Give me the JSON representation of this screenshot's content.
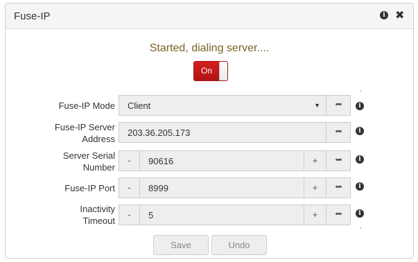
{
  "dialog": {
    "title": "Fuse-IP",
    "icons": {
      "info": "info-icon",
      "close": "close-icon"
    },
    "close_glyph": "✖",
    "info_glyph": "i"
  },
  "status_text": "Started, dialing server....",
  "toggle": {
    "label": "On",
    "state": "on",
    "accent": "#c41a1a"
  },
  "fields": {
    "mode": {
      "label": "Fuse-IP Mode",
      "value": "Client",
      "arrow": "▼"
    },
    "server_address": {
      "label_line1": "Fuse-IP Server",
      "label_line2": "Address",
      "value": "203.36.205.173"
    },
    "serial_number": {
      "label_line1": "Server Serial",
      "label_line2": "Number",
      "value": "90616",
      "minus": "-",
      "plus": "+"
    },
    "port": {
      "label": "Fuse-IP Port",
      "value": "8999",
      "minus": "-",
      "plus": "+"
    },
    "inactivity": {
      "label_line1": "Inactivity",
      "label_line2": "Timeout",
      "value": "5",
      "minus": "-",
      "plus": "+"
    }
  },
  "more_glyph": "•••",
  "buttons": {
    "save": "Save",
    "undo": "Undo"
  },
  "colors": {
    "status_text": "#7a6225",
    "panel_bg": "#f5f5f5",
    "field_bg": "#eeeeee"
  }
}
